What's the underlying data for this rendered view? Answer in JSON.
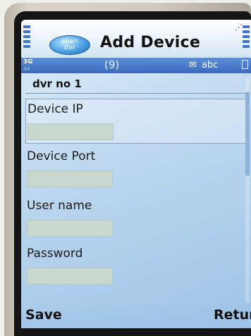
{
  "header": {
    "logo_line1": "alien",
    "logo_line2": "dvr",
    "title": "Add Device"
  },
  "status": {
    "network": "3G",
    "counter": "(9)",
    "input_mode": "abc"
  },
  "form": {
    "device_name": "dvr no 1",
    "fields": [
      {
        "label": "Device IP",
        "value": ""
      },
      {
        "label": "Device Port",
        "value": ""
      },
      {
        "label": "User name",
        "value": ""
      },
      {
        "label": "Password",
        "value": ""
      }
    ]
  },
  "softkeys": {
    "left": "Save",
    "right": "Return"
  },
  "colors": {
    "status_bar": "#3a69bd",
    "input_bg": "#c9d8cf"
  }
}
